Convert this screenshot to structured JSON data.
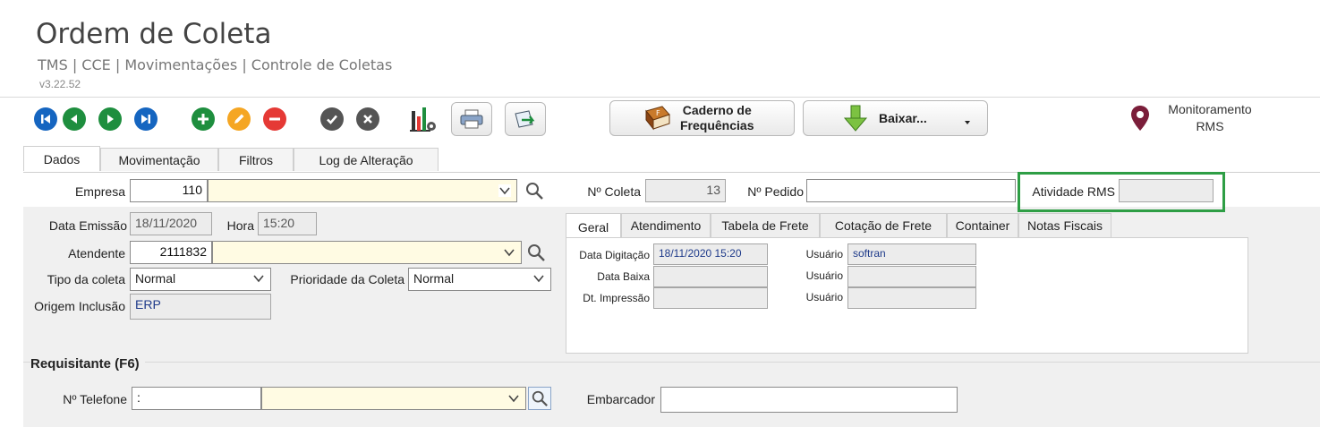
{
  "header": {
    "title": "Ordem de Coleta",
    "breadcrumb": "TMS | CCE | Movimentações | Controle de Coletas",
    "version": "v3.22.52"
  },
  "toolbar": {
    "caderno_label_1": "Caderno de",
    "caderno_label_2": "Frequências",
    "baixar_label": "Baixar...",
    "monitor_label_1": "Monitoramento",
    "monitor_label_2": "RMS",
    "icons": [
      "first-icon",
      "prev-icon",
      "next-icon",
      "last-icon",
      "add-icon",
      "edit-icon",
      "remove-icon",
      "confirm-icon",
      "cancel-icon",
      "chart-icon",
      "print-icon",
      "export-icon"
    ]
  },
  "tabs": [
    "Dados",
    "Movimentação",
    "Filtros",
    "Log de Alteração"
  ],
  "form": {
    "empresa_label": "Empresa",
    "empresa_value": "110",
    "nr_coleta_label": "Nº Coleta",
    "nr_coleta_value": "13",
    "nr_pedido_label": "Nº Pedido",
    "atividade_label": "Atividade RMS",
    "data_emissao_label": "Data Emissão",
    "data_emissao_value": "18/11/2020",
    "hora_label": "Hora",
    "hora_value": "15:20",
    "atendente_label": "Atendente",
    "atendente_value": "2111832",
    "tipo_label": "Tipo da coleta",
    "tipo_value": "Normal",
    "prioridade_label": "Prioridade da Coleta",
    "prioridade_value": "Normal",
    "origem_label": "Origem Inclusão",
    "origem_value": "ERP"
  },
  "subtabs": [
    "Geral",
    "Atendimento",
    "Tabela de Frete",
    "Cotação de Frete",
    "Container",
    "Notas Fiscais"
  ],
  "geral": {
    "data_digitacao_label": "Data Digitação",
    "data_digitacao_value": "18/11/2020 15:20",
    "data_baixa_label": "Data Baixa",
    "dt_impressao_label": "Dt. Impressão",
    "usuario_label": "Usuário",
    "usuario_value": "softran"
  },
  "requisitante": {
    "section_label": "Requisitante (F6)",
    "telefone_label": "Nº Telefone",
    "telefone_value": ":",
    "embarcador_label": "Embarcador"
  },
  "colors": {
    "nav_blue": "#1565c0",
    "nav_green": "#1e8e3e",
    "edit_orange": "#f5a623",
    "remove_red": "#e53935",
    "highlight_green": "#2e9e45"
  }
}
